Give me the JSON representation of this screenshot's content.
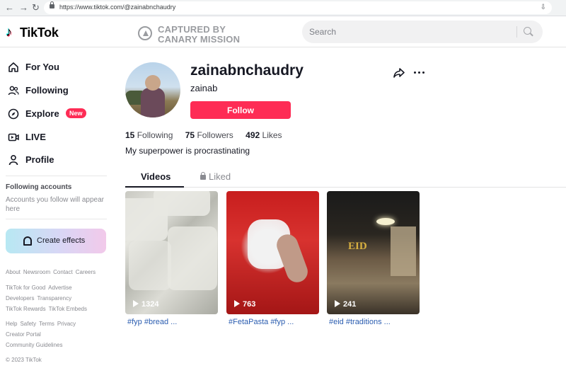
{
  "browser": {
    "back": "←",
    "forward": "→",
    "reload": "↻",
    "url": "https://www.tiktok.com/@zainabnchaudry",
    "action_icon": "⇩"
  },
  "header": {
    "logo_glyph": "♪",
    "logo_text": "TikTok",
    "watermark_line1": "CAPTURED BY",
    "watermark_line2": "CANARY MISSION",
    "search_placeholder": "Search"
  },
  "sidebar": {
    "nav": [
      {
        "label": "For You",
        "icon": "home-icon"
      },
      {
        "label": "Following",
        "icon": "users-icon"
      },
      {
        "label": "Explore",
        "icon": "compass-icon",
        "badge": "New"
      },
      {
        "label": "LIVE",
        "icon": "live-icon"
      },
      {
        "label": "Profile",
        "icon": "person-icon"
      }
    ],
    "following_heading": "Following accounts",
    "following_note": "Accounts you follow will appear here",
    "create_effects": "Create effects",
    "footer": {
      "row1": [
        "About",
        "Newsroom",
        "Contact",
        "Careers"
      ],
      "row2": [
        "TikTok for Good",
        "Advertise"
      ],
      "row3": [
        "Developers",
        "Transparency"
      ],
      "row4": [
        "TikTok Rewards",
        "TikTok Embeds"
      ],
      "row5": [
        "Help",
        "Safety",
        "Terms",
        "Privacy"
      ],
      "row6": [
        "Creator Portal"
      ],
      "row7": [
        "Community Guidelines"
      ]
    },
    "copyright": "© 2023 TikTok"
  },
  "profile": {
    "username": "zainabnchaudry",
    "nickname": "zainab",
    "follow_label": "Follow",
    "stats": [
      {
        "value": "15",
        "label": "Following"
      },
      {
        "value": "75",
        "label": "Followers"
      },
      {
        "value": "492",
        "label": "Likes"
      }
    ],
    "bio": "My superpower is procrastinating"
  },
  "tabs": {
    "videos": "Videos",
    "liked": "Liked"
  },
  "videos": [
    {
      "views": "1324",
      "caption": "#fyp #bread ..."
    },
    {
      "views": "763",
      "caption": "#FetaPasta #fyp ..."
    },
    {
      "views": "241",
      "caption": "#eid #traditions ...",
      "overlay_text": "EID"
    }
  ],
  "colors": {
    "accent": "#fe2c55",
    "link": "#2b5db0"
  }
}
